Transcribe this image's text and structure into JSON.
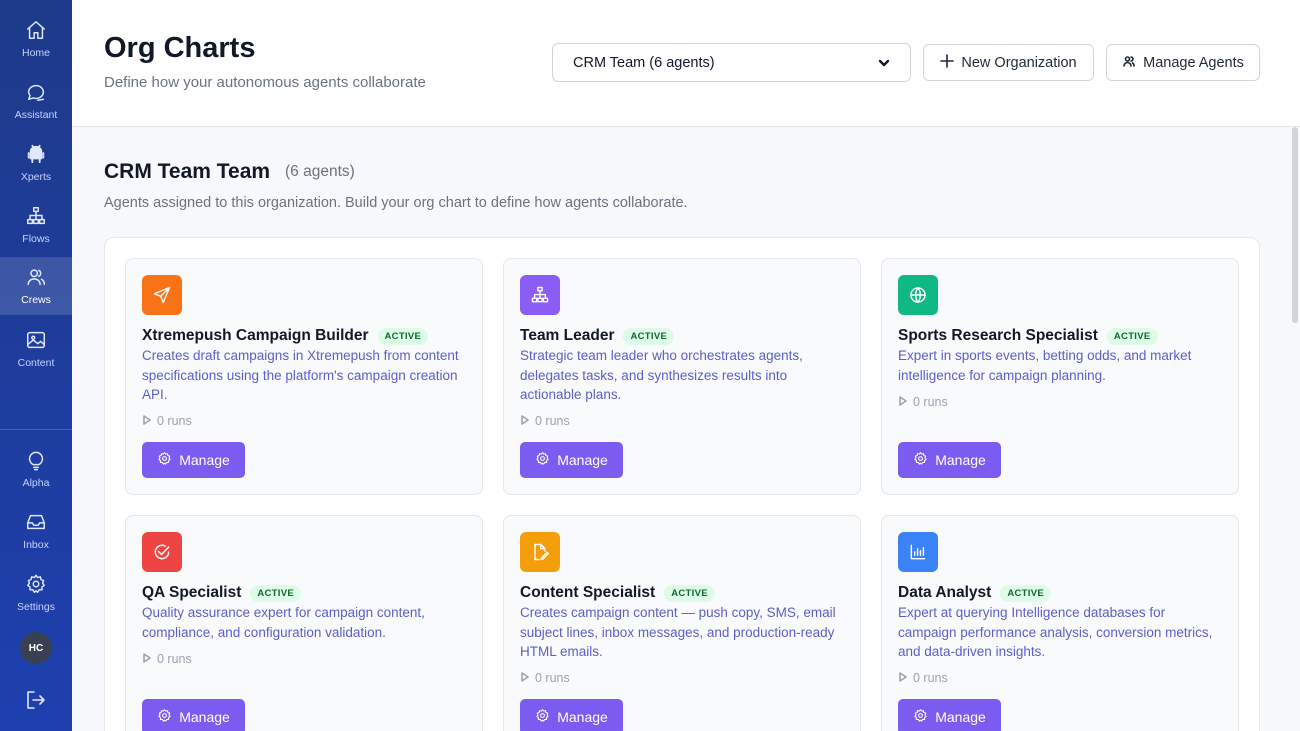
{
  "sidebar": {
    "items": [
      {
        "label": "Home",
        "icon": "home-icon"
      },
      {
        "label": "Assistant",
        "icon": "chat-icon"
      },
      {
        "label": "Xperts",
        "icon": "android-icon"
      },
      {
        "label": "Flows",
        "icon": "flow-icon"
      },
      {
        "label": "Crews",
        "icon": "users-icon",
        "active": true
      },
      {
        "label": "Content",
        "icon": "image-icon"
      },
      {
        "label": "Alpha",
        "icon": "lightbulb-icon"
      },
      {
        "label": "Inbox",
        "icon": "inbox-icon"
      },
      {
        "label": "Settings",
        "icon": "gear-icon"
      }
    ],
    "avatar_initials": "HC"
  },
  "header": {
    "title": "Org Charts",
    "subtitle": "Define how your autonomous agents collaborate",
    "org_select_value": "CRM Team (6 agents)",
    "new_org_label": "New Organization",
    "manage_agents_label": "Manage Agents"
  },
  "team": {
    "title": "CRM Team Team",
    "count": "(6 agents)",
    "description": "Agents assigned to this organization. Build your org chart to define how agents collaborate."
  },
  "colors": {
    "sidebar": "#1e40af",
    "accent": "#7c5cf0",
    "active_badge_bg": "#dcfce7",
    "active_badge_text": "#166534"
  },
  "agents": [
    {
      "name": "Xtremepush Campaign Builder",
      "status": "ACTIVE",
      "description": "Creates draft campaigns in Xtremepush from content specifications using the platform's campaign creation API.",
      "runs": "0 runs",
      "manage_label": "Manage",
      "icon": "send-icon",
      "color": "#f97316"
    },
    {
      "name": "Team Leader",
      "status": "ACTIVE",
      "description": "Strategic team leader who orchestrates agents, delegates tasks, and synthesizes results into actionable plans.",
      "runs": "0 runs",
      "manage_label": "Manage",
      "icon": "hierarchy-icon",
      "color": "#8b5cf6"
    },
    {
      "name": "Sports Research Specialist",
      "status": "ACTIVE",
      "description": "Expert in sports events, betting odds, and market intelligence for campaign planning.",
      "runs": "0 runs",
      "manage_label": "Manage",
      "icon": "globe-icon",
      "color": "#10b981"
    },
    {
      "name": "QA Specialist",
      "status": "ACTIVE",
      "description": "Quality assurance expert for campaign content, compliance, and configuration validation.",
      "runs": "0 runs",
      "manage_label": "Manage",
      "icon": "check-circle-icon",
      "color": "#ef4444"
    },
    {
      "name": "Content Specialist",
      "status": "ACTIVE",
      "description": "Creates campaign content — push copy, SMS, email subject lines, inbox messages, and production-ready HTML emails.",
      "runs": "0 runs",
      "manage_label": "Manage",
      "icon": "edit-file-icon",
      "color": "#f59e0b"
    },
    {
      "name": "Data Analyst",
      "status": "ACTIVE",
      "description": "Expert at querying Intelligence databases for campaign performance analysis, conversion metrics, and data-driven insights.",
      "runs": "0 runs",
      "manage_label": "Manage",
      "icon": "bar-chart-icon",
      "color": "#3b82f6"
    }
  ]
}
